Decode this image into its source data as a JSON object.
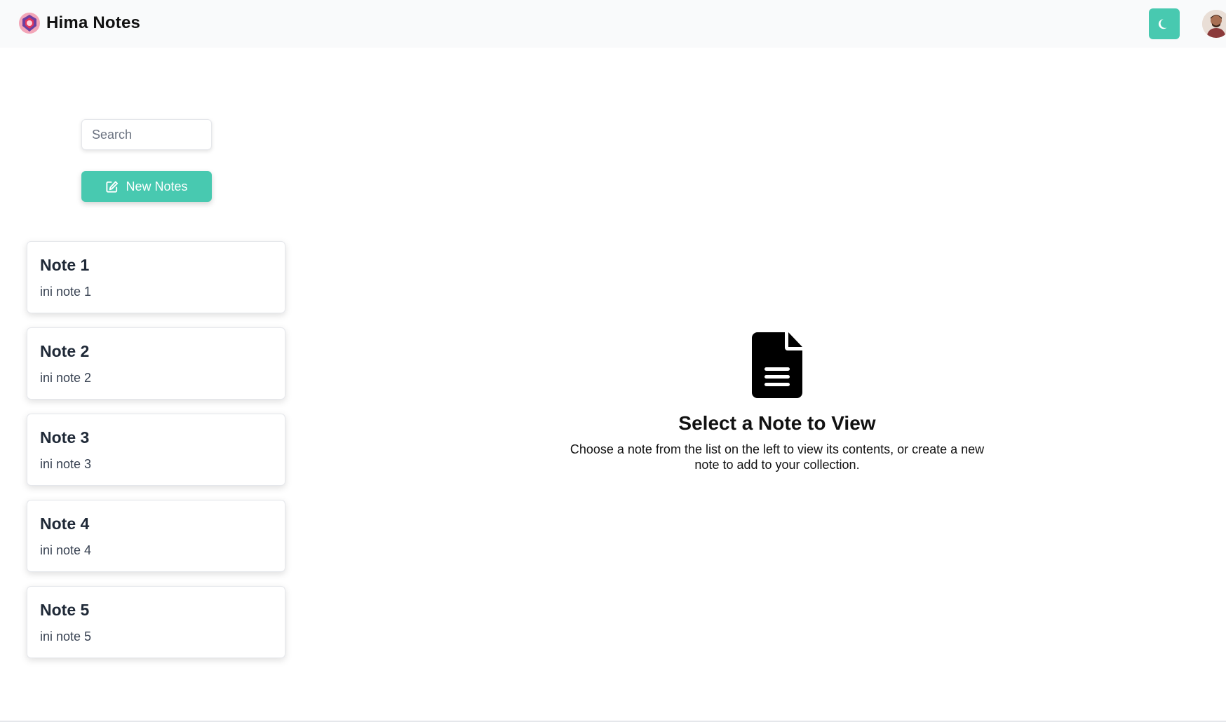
{
  "header": {
    "title": "Hima Notes",
    "logo_icon": "hima-logo-icon",
    "theme_toggle_icon": "moon-icon",
    "accent_color": "#48c9b0"
  },
  "sidebar": {
    "search_placeholder": "Search",
    "new_button_label": "New Notes",
    "new_button_icon": "edit-icon",
    "notes": [
      {
        "title": "Note 1",
        "body": "ini note 1"
      },
      {
        "title": "Note 2",
        "body": "ini note 2"
      },
      {
        "title": "Note 3",
        "body": "ini note 3"
      },
      {
        "title": "Note 4",
        "body": "ini note 4"
      },
      {
        "title": "Note 5",
        "body": "ini note 5"
      }
    ]
  },
  "main": {
    "empty_icon": "document-icon",
    "empty_title": "Select a Note to View",
    "empty_description": "Choose a note from the list on the left to view its contents, or create a new note to add to your collection."
  }
}
